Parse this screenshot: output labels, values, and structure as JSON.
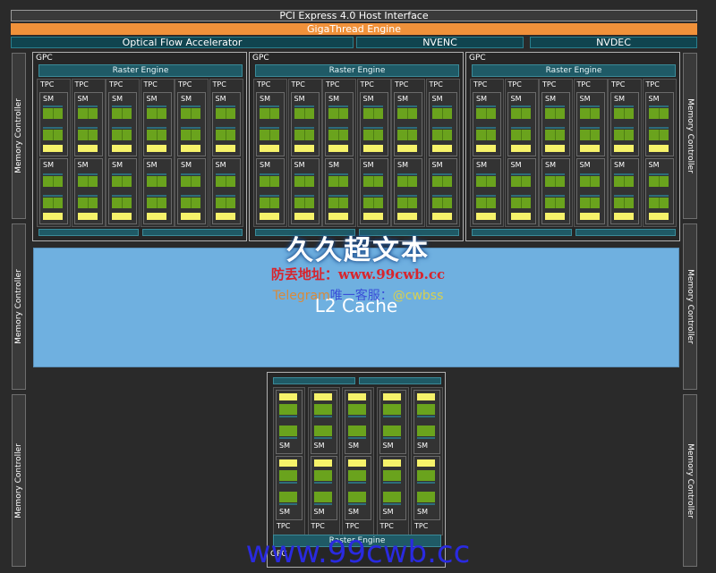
{
  "top_bars": {
    "pcie": "PCI Express 4.0 Host Interface",
    "gigathread": "GigaThread Engine",
    "optical_flow": "Optical Flow Accelerator",
    "nvenc": "NVENC",
    "nvdec": "NVDEC"
  },
  "memory_controller": "Memory Controller",
  "gpc": {
    "label": "GPC",
    "raster_engine": "Raster Engine",
    "tpc_label": "TPC",
    "sm_label": "SM",
    "tpc_count": 6,
    "sm_per_tpc": 2
  },
  "l2_cache": "L2 Cache",
  "watermark": {
    "title": "久久超文本",
    "address": "防丢地址：www.99cwb.cc",
    "telegram": "Telegram",
    "contact": "唯一客服：",
    "handle": "@cwbss",
    "url": "www.99cwb.cc"
  },
  "colors": {
    "gigathread": "#f0913a",
    "l2": "#6fb0e0",
    "raster": "#1f5a66",
    "core": "#6aa31d",
    "rt_core": "#f6f26a"
  }
}
